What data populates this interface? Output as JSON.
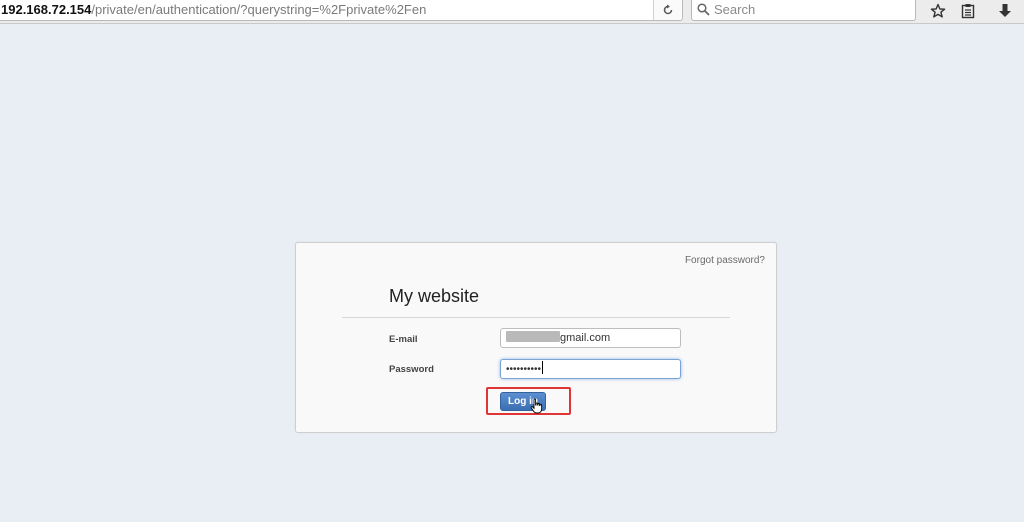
{
  "browser": {
    "url_host": "192.168.72.154",
    "url_path": "/private/en/authentication/?querystring=%2Fprivate%2Fen",
    "search_placeholder": "Search",
    "reload_icon": "reload-icon",
    "toolbar_icons": [
      "bookmark-star-icon",
      "reading-list-icon",
      "download-icon"
    ]
  },
  "login": {
    "forgot_password": "Forgot password?",
    "title": "My website",
    "email_label": "E-mail",
    "email_value": "gmail.com",
    "password_label": "Password",
    "password_value": "••••••••••",
    "login_button": "Log in",
    "highlight_color": "#e03535",
    "button_color": "#4a7fc2"
  }
}
